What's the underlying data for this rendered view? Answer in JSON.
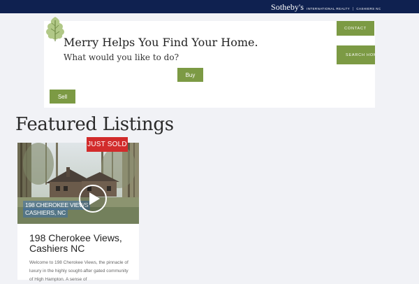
{
  "header": {
    "brand_name": "Sotheby's",
    "brand_sub": "INTERNATIONAL REALTY",
    "brand_sep": "|",
    "brand_location": "CASHIERS NC"
  },
  "chat": {
    "title": "Merry Helps You Find Your Home.",
    "subtitle": "What would you like to do?",
    "buy_label": "Buy",
    "sell_label": "Sell"
  },
  "nav": {
    "contact_label": "CONTACT",
    "search_label": "SEARCH HOMES"
  },
  "featured": {
    "title": "Featured Listings",
    "listings": [
      {
        "badge": "JUST SOLD",
        "caption_line1": "198 CHEROKEE VIEWS",
        "caption_line2": "CASHIERS, NC",
        "title": "198 Cherokee Views, Cashiers NC",
        "description": "Welcome to 198 Cherokee Views, the pinnacle of luxury in the highly sought-after gated community of High Hampton. A sense of"
      }
    ]
  },
  "colors": {
    "header_bg": "#0f2150",
    "accent_green": "#7c9a44",
    "sold_red": "#d22b2b"
  }
}
